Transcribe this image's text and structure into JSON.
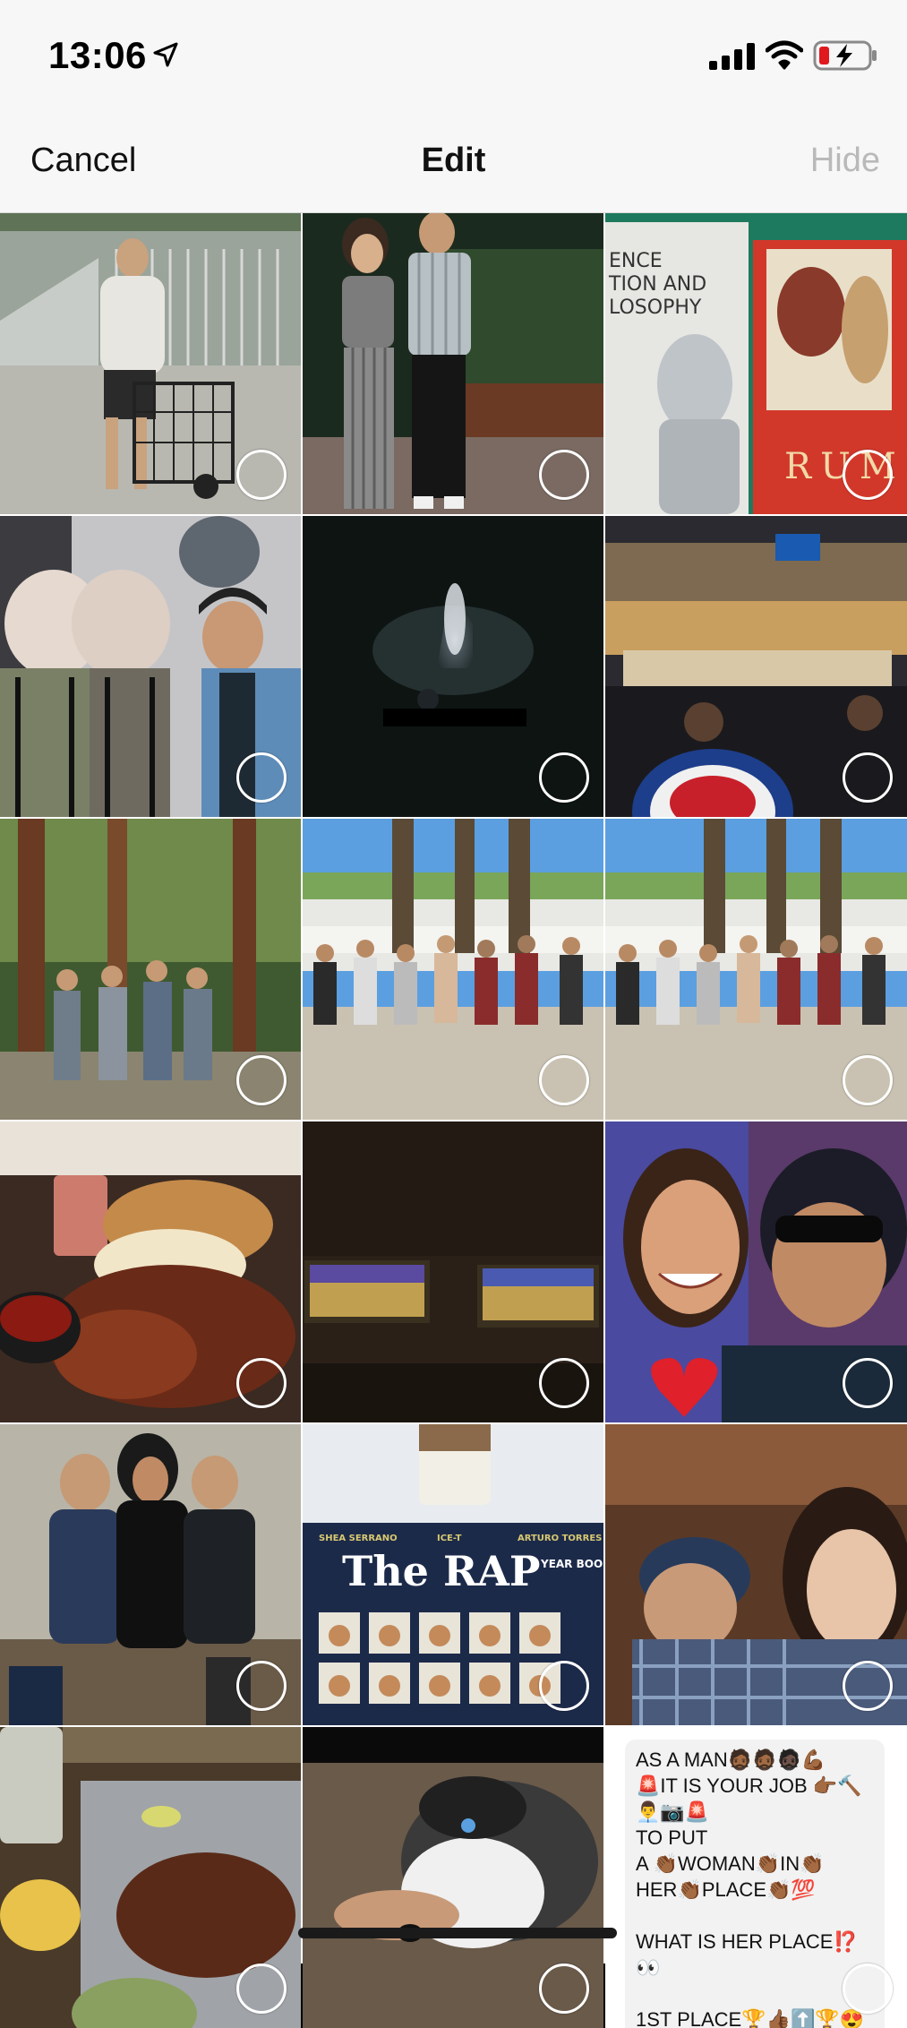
{
  "status_bar": {
    "time": "13:06",
    "location_icon": "location-arrow-icon",
    "signal_icon": "cellular-signal-icon",
    "wifi_icon": "wifi-icon",
    "battery_icon": "battery-charging-icon",
    "battery_color": "#e0191f"
  },
  "nav": {
    "cancel_label": "Cancel",
    "title": "Edit",
    "hide_label": "Hide"
  },
  "grid": {
    "photos": [
      {
        "subject": "man-with-cart"
      },
      {
        "subject": "couple-at-night"
      },
      {
        "subject": "books"
      },
      {
        "subject": "costume-figures"
      },
      {
        "subject": "concert-spotlight"
      },
      {
        "subject": "arena-game"
      },
      {
        "subject": "group-in-forest"
      },
      {
        "subject": "group-desert"
      },
      {
        "subject": "group-desert-2"
      },
      {
        "subject": "burger"
      },
      {
        "subject": "tv-screens"
      },
      {
        "subject": "selfie-couple"
      },
      {
        "subject": "three-friends"
      },
      {
        "subject": "rap-year-book"
      },
      {
        "subject": "selfie-hats"
      },
      {
        "subject": "ribs-meal"
      },
      {
        "subject": "husky-dog"
      },
      {
        "subject": "text-note"
      }
    ],
    "book_rumi_text": "RUMI",
    "book_rap_title": "The RAP",
    "book_rap_subtitle": "YEAR BOOK",
    "book_rap_authors_left": "SHEA SERRANO",
    "book_rap_authors_mid": "ICE-T",
    "book_rap_authors_right": "ARTURO TORRES",
    "book_left_text": "ENCE\nTION AND\nLOSOPHY",
    "note_text": "AS A MAN🧔🏾🧔🏾🧔🏿💪🏾\n🚨IT IS YOUR JOB 👉🏾🔨\n👨‍💼📷🚨\nTO PUT\nA 👏🏾WOMAN👏🏾IN👏🏾\nHER👏🏾PLACE👏🏾💯\n\nWHAT IS HER PLACE⁉️\n👀\n\n1ST PLACE🏆👍🏾⬆️🏆😍"
  },
  "colors": {
    "nav_background": "#f7f7f7",
    "hide_disabled": "#b9b9b9"
  }
}
